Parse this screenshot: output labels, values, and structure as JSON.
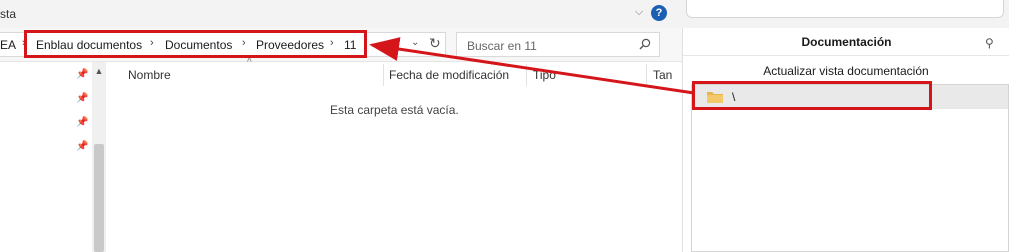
{
  "window": {
    "top_tab_text": "sta",
    "chevron_glyph": "⌵",
    "help_glyph": "?"
  },
  "address_bar": {
    "prefix_fragment": "EA",
    "breadcrumbs": [
      "Enblau documentos",
      "Documentos",
      "Proveedores",
      "11"
    ],
    "separator_glyph": "›",
    "dropdown_glyph": "⌄",
    "refresh_glyph": "↻"
  },
  "search": {
    "placeholder": "Buscar en 11",
    "icon": "search-icon"
  },
  "file_list": {
    "columns": [
      "Nombre",
      "Fecha de modificación",
      "Tipo",
      "Tan"
    ],
    "sort_caret": "^",
    "empty_message": "Esta carpeta está vacía."
  },
  "nav_pane": {
    "pin_glyph": "📌",
    "scroll_up_glyph": "▲"
  },
  "doc_panel": {
    "title": "Documentación",
    "pin_glyph": "⚲",
    "refresh_label": "Actualizar vista documentación",
    "tree_items": [
      {
        "label": "\\",
        "icon": "folder-icon"
      }
    ]
  },
  "colors": {
    "annotation_red": "#d4161b",
    "help_blue": "#1a5fb4",
    "folder_yellow": "#e8b64c"
  }
}
